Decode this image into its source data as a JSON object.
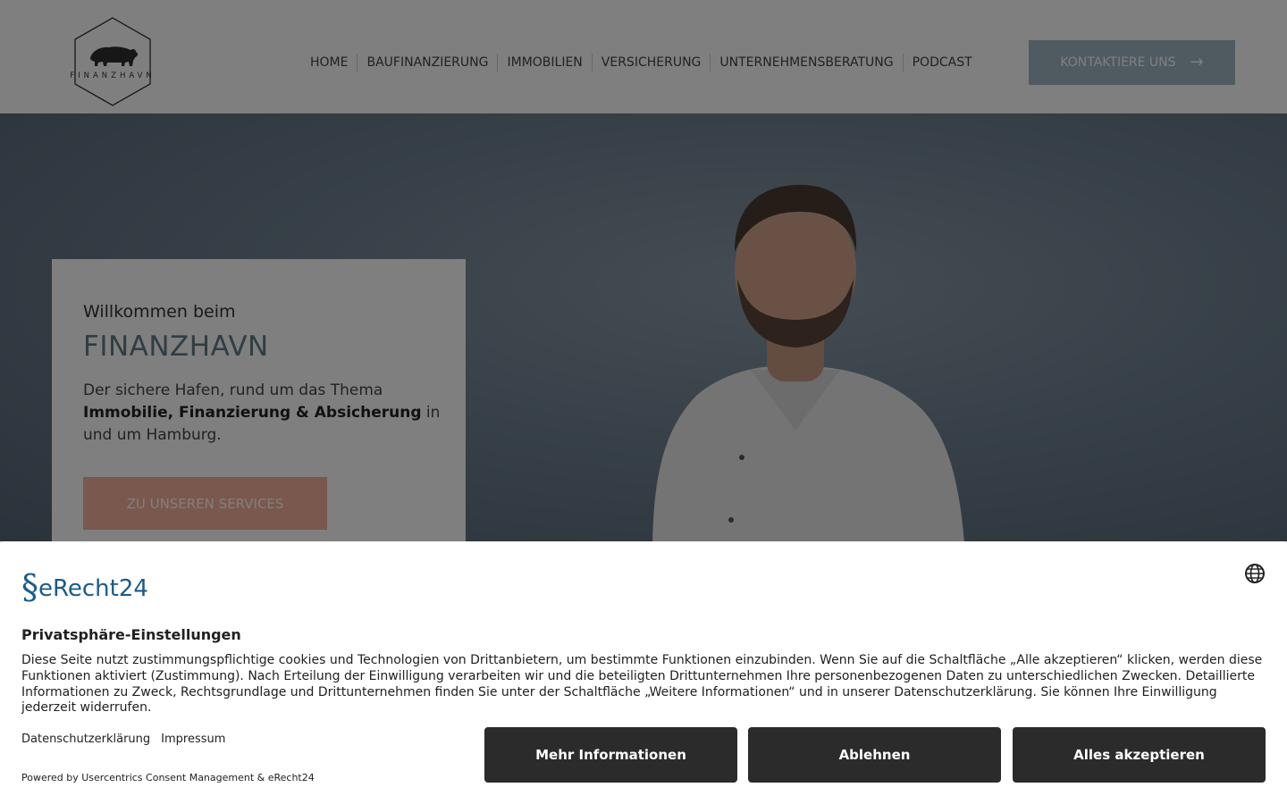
{
  "header": {
    "logo_text": "FINANZHAVN",
    "nav": [
      {
        "label": "HOME"
      },
      {
        "label": "BAUFINANZIERUNG"
      },
      {
        "label": "IMMOBILIEN"
      },
      {
        "label": "VERSICHERUNG"
      },
      {
        "label": "UNTERNEHMENSBERATUNG"
      },
      {
        "label": "PODCAST"
      }
    ],
    "cta_label": "KONTAKTIERE UNS",
    "cta_icon": "arrow-right-icon"
  },
  "hero": {
    "pre_title": "Willkommen beim",
    "title": "FINANZHAVN",
    "text_1": "Der sichere Hafen, rund um das Thema",
    "text_bold": "Immobilie, Finanzierung & Absicherung",
    "text_2": " in und um Hamburg.",
    "button_label": "ZU UNSEREN SERVICES"
  },
  "consent": {
    "brand": "eRecht24",
    "language_icon": "globe-icon",
    "title": "Privatsphäre-Einstellungen",
    "body": "Diese Seite nutzt zustimmungspflichtige cookies und Technologien von Drittanbietern, um bestimmte Funktionen einzubinden. Wenn Sie auf die Schaltfläche „Alle akzeptieren“ klicken, werden diese Funktionen aktiviert (Zustimmung). Nach Erteilung der Einwilligung verarbeiten wir und die beteiligten Drittunternehmen Ihre personenbezogenen Daten zu unterschiedlichen Zwecken. Detaillierte Informationen zu Zweck, Rechtsgrundlage und Drittunternehmen finden Sie unter der Schaltfläche „Weitere Informationen“ und in unserer Datenschutzerklärung. Sie können Ihre Einwilligung jederzeit widerrufen.",
    "link_privacy": "Datenschutzerklärung",
    "link_imprint": "Impressum",
    "powered": "Powered by Usercentrics Consent Management & eRecht24",
    "btn_more": "Mehr Informationen",
    "btn_deny": "Ablehnen",
    "btn_accept": "Alles akzeptieren"
  },
  "colors": {
    "cta": "#9fb7c0",
    "accent_title": "#5e7d8a",
    "services_button": "#f5b09a",
    "consent_button": "#2b2b2b",
    "erecht_blue": "#1a5b8a"
  }
}
